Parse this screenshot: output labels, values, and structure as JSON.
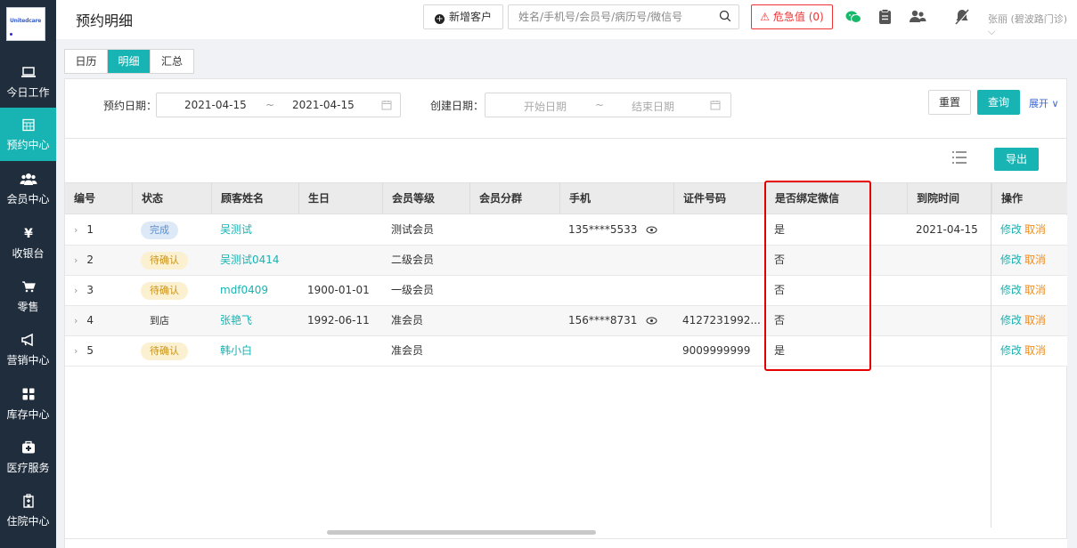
{
  "logo": {
    "text": "Unitedcare"
  },
  "sidebar": {
    "items": [
      {
        "id": "workday",
        "label": "今日工作",
        "icon": "laptop-icon",
        "active": false
      },
      {
        "id": "appointments",
        "label": "预约中心",
        "icon": "calendar-icon",
        "active": true
      },
      {
        "id": "members",
        "label": "会员中心",
        "icon": "users-icon",
        "active": false
      },
      {
        "id": "cashier",
        "label": "收银台",
        "icon": "yen-icon",
        "active": false
      },
      {
        "id": "retail",
        "label": "零售",
        "icon": "cart-icon",
        "active": false
      },
      {
        "id": "marketing",
        "label": "营销中心",
        "icon": "megaphone-icon",
        "active": false
      },
      {
        "id": "inventory",
        "label": "库存中心",
        "icon": "grid-icon",
        "active": false
      },
      {
        "id": "medical",
        "label": "医疗服务",
        "icon": "medkit-icon",
        "active": false
      },
      {
        "id": "inpatient",
        "label": "住院中心",
        "icon": "hospital-icon",
        "active": false
      }
    ]
  },
  "header": {
    "title": "预约明细",
    "add_customer": "新增客户",
    "search_placeholder": "姓名/手机号/会员号/病历号/微信号",
    "danger_label": "危急值",
    "danger_count": "0",
    "user": "张丽 (碧波路门诊)"
  },
  "tabs": [
    {
      "label": "日历",
      "active": false
    },
    {
      "label": "明细",
      "active": true
    },
    {
      "label": "汇总",
      "active": false
    }
  ],
  "filters": {
    "appt_date_label": "预约日期：",
    "appt_date_start": "2021-04-15",
    "appt_date_end": "2021-04-15",
    "range_sep": "~",
    "create_date_label": "创建日期：",
    "create_start_placeholder": "开始日期",
    "create_end_placeholder": "结束日期",
    "reset": "重置",
    "query": "查询",
    "expand": "展开"
  },
  "toolbar": {
    "export": "导出"
  },
  "table": {
    "columns": [
      "编号",
      "状态",
      "顾客姓名",
      "生日",
      "会员等级",
      "会员分群",
      "手机",
      "证件号码",
      "是否绑定微信",
      "到院时间",
      "操作"
    ],
    "rows": [
      {
        "no": "1",
        "status": "完成",
        "status_type": "done",
        "name": "吴测试",
        "birthday": "",
        "level": "测试会员",
        "group": "",
        "phone": "135****5533",
        "has_eye": true,
        "id_no": "",
        "wechat": "是",
        "arrival": "2021-04-15",
        "edit": "修改",
        "cancel": "取消"
      },
      {
        "no": "2",
        "status": "待确认",
        "status_type": "pending",
        "name": "吴测试0414",
        "birthday": "",
        "level": "二级会员",
        "group": "",
        "phone": "",
        "has_eye": false,
        "id_no": "",
        "wechat": "否",
        "arrival": "",
        "edit": "修改",
        "cancel": "取消"
      },
      {
        "no": "3",
        "status": "待确认",
        "status_type": "pending",
        "name": "mdf0409",
        "birthday": "1900-01-01",
        "level": "一级会员",
        "group": "",
        "phone": "",
        "has_eye": false,
        "id_no": "",
        "wechat": "否",
        "arrival": "",
        "edit": "修改",
        "cancel": "取消"
      },
      {
        "no": "4",
        "status": "到店",
        "status_type": "plain",
        "name": "张艳飞",
        "birthday": "1992-06-11",
        "level": "准会员",
        "group": "",
        "phone": "156****8731",
        "has_eye": true,
        "id_no": "4127231992...",
        "wechat": "否",
        "arrival": "",
        "edit": "修改",
        "cancel": "取消"
      },
      {
        "no": "5",
        "status": "待确认",
        "status_type": "pending",
        "name": "韩小白",
        "birthday": "",
        "level": "准会员",
        "group": "",
        "phone": "",
        "has_eye": false,
        "id_no": "9009999999",
        "wechat": "是",
        "arrival": "",
        "edit": "修改",
        "cancel": "取消"
      }
    ]
  },
  "colors": {
    "accent": "#18b3b3",
    "sidebar": "#1f2d3d",
    "danger": "#e33333",
    "highlight": "#e50000",
    "cancel_link": "#f08c1c"
  }
}
